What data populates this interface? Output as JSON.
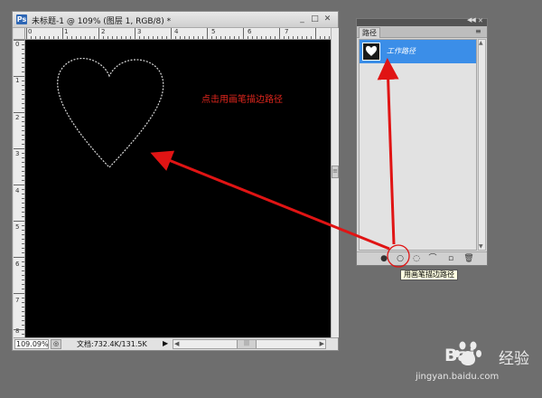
{
  "document": {
    "title": "未标题-1 @ 109% (图层 1, RGB/8) *",
    "app_icon": "Ps",
    "zoom": "109.09%",
    "info": "文档:732.4K/131.5K",
    "ruler_top_labels": [
      "0",
      "1",
      "2",
      "3",
      "4",
      "5",
      "6",
      "7"
    ],
    "ruler_left_labels": [
      "0",
      "1",
      "2",
      "3",
      "4",
      "5",
      "6",
      "7",
      "8"
    ]
  },
  "canvas": {
    "background": "#000000",
    "annotation": "点击用画笔描边路径",
    "annotation_color": "#e0261d"
  },
  "paths_panel": {
    "tab": "路径",
    "selected_path": "工作路径",
    "selection_color": "#3b8ee8",
    "tooltip": "用画笔描边路径",
    "bottom_icons": [
      "fill-path-icon",
      "stroke-path-icon",
      "load-selection-icon",
      "make-work-path-icon",
      "new-path-icon",
      "delete-path-icon"
    ]
  },
  "watermark": {
    "logo": "Bai",
    "logo_suffix": "经验",
    "url": "jingyan.baidu.com"
  },
  "arrow_color": "#e01414"
}
